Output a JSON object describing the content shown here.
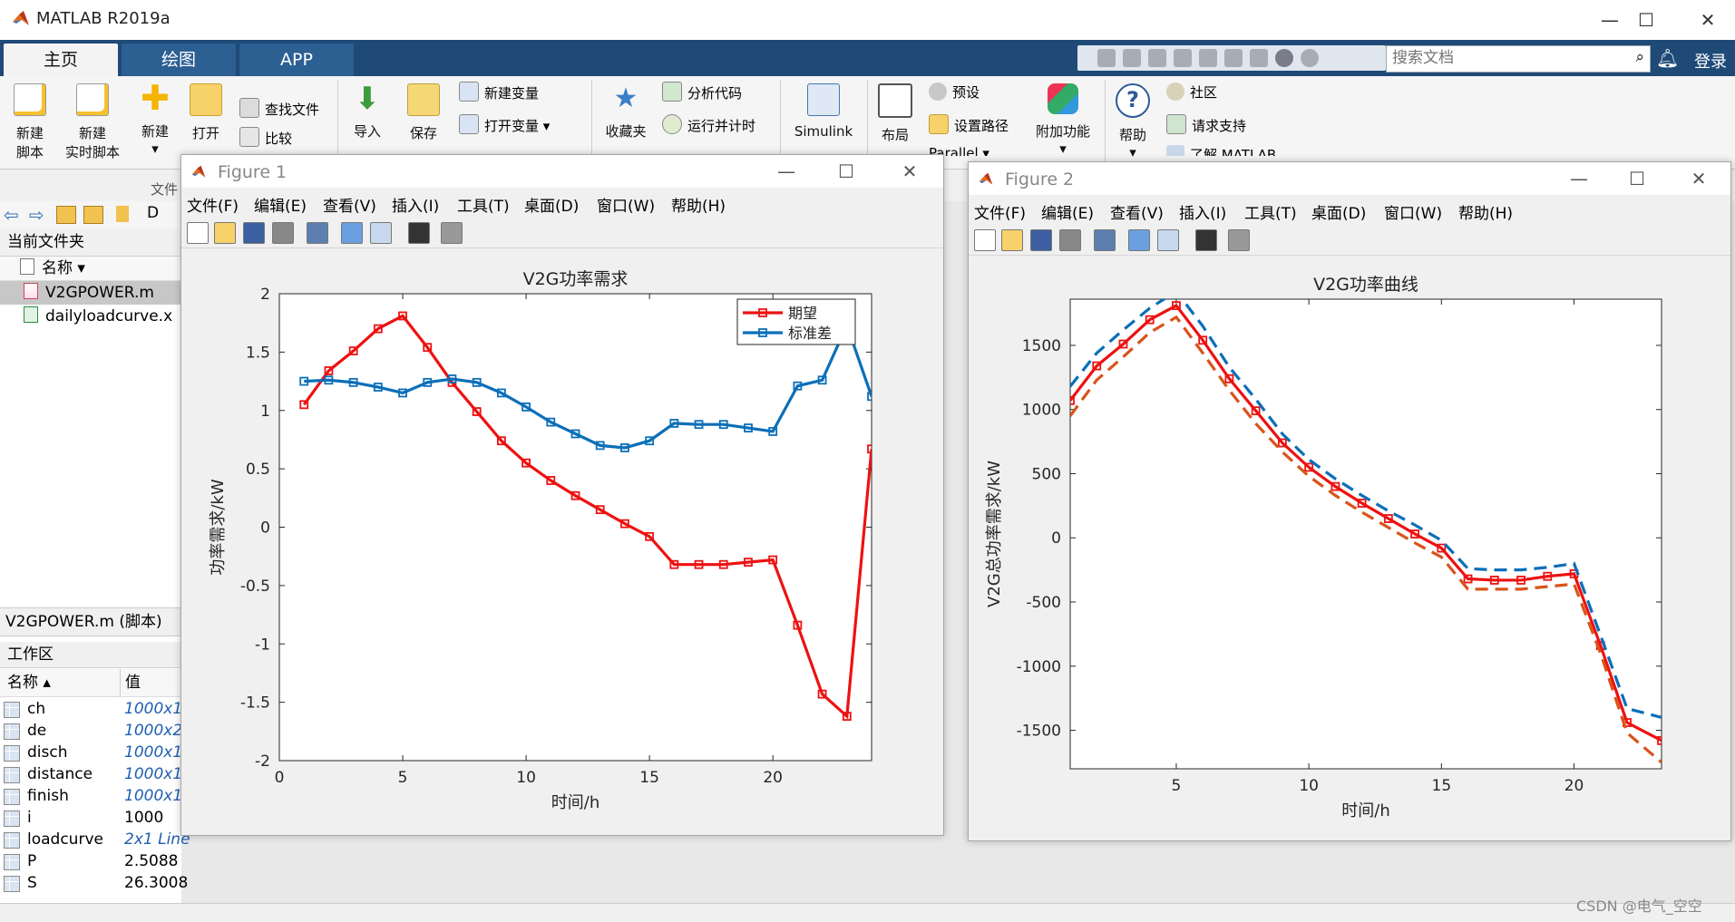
{
  "app": {
    "title": "MATLAB R2019a"
  },
  "tabs": [
    "主页",
    "绘图",
    "APP"
  ],
  "search": {
    "placeholder": "搜索文档"
  },
  "login_label": "登录",
  "ribbon": {
    "new_script": "新建\n脚本",
    "new_script_l1": "新建",
    "new_script_l2": "脚本",
    "new_live_l1": "新建",
    "new_live_l2": "实时脚本",
    "new_label": "新建",
    "open_label": "打开",
    "find_files": "查找文件",
    "compare": "比较",
    "import_label": "导入",
    "save_label": "保存",
    "new_variable": "新建变量",
    "open_variable": "打开变量",
    "favorites": "收藏夹",
    "analyze_code": "分析代码",
    "run_and_time": "运行并计时",
    "simulink": "Simulink",
    "layout": "布局",
    "preferences": "预设",
    "set_path": "设置路径",
    "parallel": "Parallel",
    "addons": "附加功能",
    "help": "帮助",
    "community": "社区",
    "request_support": "请求支持",
    "learn_matlab": "了解 MATLAB",
    "file_group": "文件"
  },
  "address": {
    "path": "D"
  },
  "current_folder": {
    "title": "当前文件夹",
    "name_col": "名称",
    "files": [
      "V2GPOWER.m",
      "dailyloadcurve.x"
    ]
  },
  "details_label": "V2GPOWER.m (脚本)",
  "workspace": {
    "title": "工作区",
    "name_col": "名称",
    "value_col": "值",
    "vars": [
      {
        "name": "ch",
        "value": "1000x1",
        "italic": true
      },
      {
        "name": "de",
        "value": "1000x2",
        "italic": true
      },
      {
        "name": "disch",
        "value": "1000x1",
        "italic": true
      },
      {
        "name": "distance",
        "value": "1000x1",
        "italic": true
      },
      {
        "name": "finish",
        "value": "1000x1",
        "italic": true
      },
      {
        "name": "i",
        "value": "1000",
        "italic": false
      },
      {
        "name": "loadcurve",
        "value": "2x1 Line",
        "italic": true
      },
      {
        "name": "P",
        "value": "2.5088",
        "italic": false
      },
      {
        "name": "S",
        "value": "26.3008",
        "italic": false
      }
    ]
  },
  "figure_menu": [
    "文件(F)",
    "编辑(E)",
    "查看(V)",
    "插入(I)",
    "工具(T)",
    "桌面(D)",
    "窗口(W)",
    "帮助(H)"
  ],
  "figure1": {
    "window_title": "Figure 1"
  },
  "figure2": {
    "window_title": "Figure 2"
  },
  "watermark": "CSDN @电气_空空",
  "colors": {
    "red": "#ee1111",
    "blue": "#0b6fb8",
    "orange": "#d95319",
    "tabbar": "#1f4a78"
  },
  "chart_data": [
    {
      "type": "line",
      "title": "V2G功率需求",
      "xlabel": "时间/h",
      "ylabel": "功率需求/kW",
      "xlim": [
        0,
        24
      ],
      "ylim": [
        -2,
        2
      ],
      "xticks": [
        0,
        5,
        10,
        15,
        20
      ],
      "yticks": [
        -2,
        -1.5,
        -1,
        -0.5,
        0,
        0.5,
        1,
        1.5,
        2
      ],
      "legend": "top-right",
      "series": [
        {
          "name": "期望",
          "color": "#ee1111",
          "x": [
            1,
            2,
            3,
            4,
            5,
            6,
            7,
            8,
            9,
            10,
            11,
            12,
            13,
            14,
            15,
            16,
            17,
            18,
            19,
            20,
            21,
            22,
            23,
            24
          ],
          "y": [
            1.05,
            1.34,
            1.51,
            1.7,
            1.81,
            1.54,
            1.24,
            0.99,
            0.74,
            0.55,
            0.4,
            0.27,
            0.15,
            0.03,
            -0.08,
            -0.32,
            -0.32,
            -0.32,
            -0.3,
            -0.28,
            -0.84,
            -1.43,
            -1.62,
            0.67
          ]
        },
        {
          "name": "标准差",
          "color": "#0b6fb8",
          "x": [
            1,
            2,
            3,
            4,
            5,
            6,
            7,
            8,
            9,
            10,
            11,
            12,
            13,
            14,
            15,
            16,
            17,
            18,
            19,
            20,
            21,
            22,
            23,
            24
          ],
          "y": [
            1.25,
            1.26,
            1.24,
            1.2,
            1.15,
            1.24,
            1.27,
            1.24,
            1.15,
            1.03,
            0.9,
            0.8,
            0.7,
            0.68,
            0.74,
            0.89,
            0.88,
            0.88,
            0.85,
            0.82,
            1.21,
            1.26,
            1.73,
            1.12
          ]
        }
      ]
    },
    {
      "type": "line",
      "title": "V2G功率曲线",
      "xlabel": "时间/h",
      "ylabel": "V2G总功率需求/kW",
      "xlim": [
        1,
        23.3
      ],
      "ylim": [
        -1800,
        1860
      ],
      "xticks": [
        5,
        10,
        15,
        20
      ],
      "yticks": [
        -1500,
        -1000,
        -500,
        0,
        500,
        1000,
        1500
      ],
      "series": [
        {
          "color": "#ee1111",
          "style": "solid-markers",
          "x": [
            1,
            2,
            3,
            4,
            5,
            6,
            7,
            8,
            9,
            10,
            11,
            12,
            13,
            14,
            15,
            16,
            17,
            18,
            19,
            20,
            21,
            22,
            23.3
          ],
          "y": [
            1070,
            1340,
            1510,
            1700,
            1810,
            1540,
            1240,
            990,
            740,
            550,
            400,
            270,
            150,
            30,
            -80,
            -320,
            -330,
            -330,
            -300,
            -280,
            -840,
            -1440,
            -1580
          ]
        },
        {
          "color": "#0b6fb8",
          "style": "dashed",
          "x": [
            1,
            2,
            3,
            4,
            5,
            6,
            7,
            8,
            9,
            10,
            11,
            12,
            13,
            14,
            15,
            16,
            17,
            18,
            19,
            20,
            21,
            22,
            23.3
          ],
          "y": [
            1180,
            1440,
            1620,
            1790,
            1920,
            1650,
            1330,
            1080,
            810,
            610,
            460,
            330,
            210,
            100,
            -20,
            -240,
            -250,
            -250,
            -230,
            -200,
            -760,
            -1330,
            -1400
          ]
        },
        {
          "color": "#d95319",
          "style": "dashed",
          "x": [
            1,
            2,
            3,
            4,
            5,
            6,
            7,
            8,
            9,
            10,
            11,
            12,
            13,
            14,
            15,
            16,
            17,
            18,
            19,
            20,
            21,
            22,
            23.3
          ],
          "y": [
            950,
            1230,
            1410,
            1600,
            1720,
            1440,
            1150,
            890,
            670,
            480,
            330,
            200,
            80,
            -40,
            -150,
            -400,
            -400,
            -400,
            -380,
            -360,
            -900,
            -1520,
            -1750
          ]
        }
      ]
    }
  ]
}
